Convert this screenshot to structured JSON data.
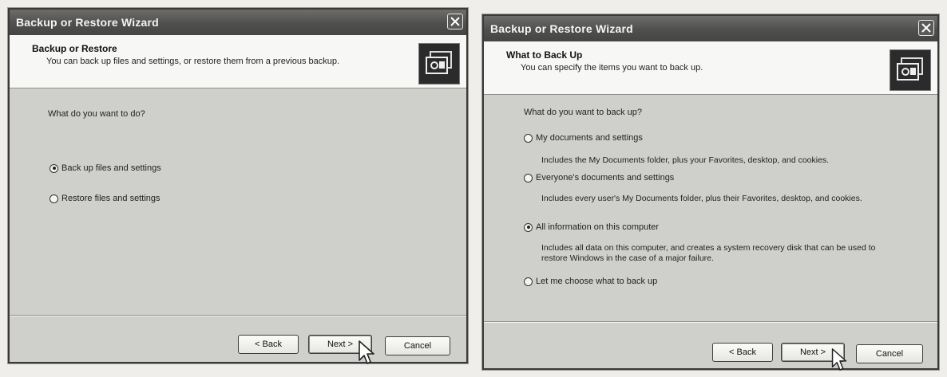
{
  "windows": [
    {
      "title": "Backup or Restore Wizard",
      "header_title": "Backup or Restore",
      "header_subtitle": "You can back up files and settings, or restore them from a previous backup.",
      "question": "What do you want to do?",
      "options": [
        {
          "label": "Back up files and settings",
          "checked": true
        },
        {
          "label": "Restore files and settings",
          "checked": false
        }
      ],
      "buttons": {
        "back": "< Back",
        "next": "Next >",
        "cancel": "Cancel"
      }
    },
    {
      "title": "Backup or Restore Wizard",
      "header_title": "What to Back Up",
      "header_subtitle": "You can specify the items you want to back up.",
      "question": "What do you want to back up?",
      "options": [
        {
          "label": "My documents and settings",
          "checked": false,
          "description": "Includes the My Documents folder, plus your Favorites, desktop, and cookies."
        },
        {
          "label": "Everyone's documents and settings",
          "checked": false,
          "description": "Includes every user's My Documents folder, plus their Favorites, desktop, and cookies."
        },
        {
          "label": "All information on this computer",
          "checked": true,
          "description": "Includes all data on this computer, and creates a system recovery disk that can be used to restore Windows in the case of a major failure."
        },
        {
          "label": "Let me choose what to back up",
          "checked": false
        }
      ],
      "buttons": {
        "back": "< Back",
        "next": "Next >",
        "cancel": "Cancel"
      }
    }
  ],
  "icons": [
    "close-icon",
    "backup-wizard-icon",
    "mouse-pointer-icon"
  ],
  "colors": {
    "titlebar": "#4f4f4d",
    "header": "#f7f7f5",
    "body": "#cfcfcc"
  }
}
